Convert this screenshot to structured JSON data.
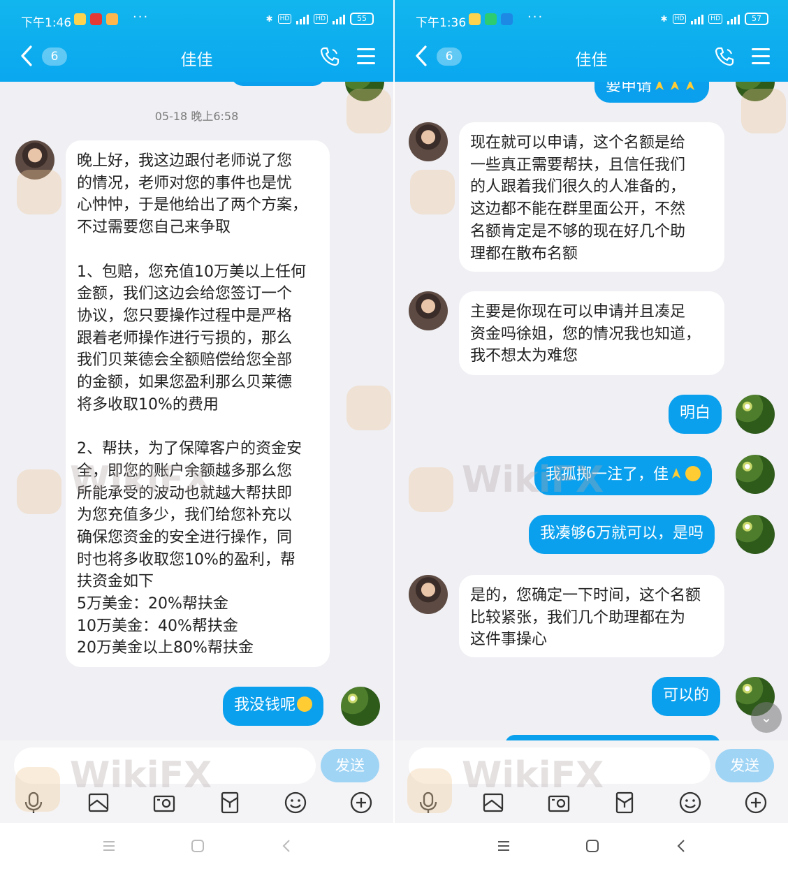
{
  "left": {
    "status": {
      "time": "下午1:46",
      "battery": "55"
    },
    "header": {
      "unread_badge": "6",
      "title": "佳佳"
    },
    "timestamp": "05-18 晚上6:58",
    "messages": [
      {
        "from": "them",
        "text": "晚上好，我这边跟付老师说了您\n的情况，老师对您的事件也是忧\n心忡忡，于是他给出了两个方案，\n不过需要您自己来争取\n\n1、包赔，您充值10万美以上任何\n金额，我们这边会给您签订一个\n协议，您只要操作过程中是严格\n跟着老师操作进行亏损的，那么\n我们贝莱德会全额赔偿给您全部\n的金额，如果您盈利那么贝莱德\n将多收取10%的费用\n\n2、帮扶，为了保障客户的资金安\n全，即您的账户余额越多那么您\n所能承受的波动也就越大帮扶即\n为您充值多少，我们给您补充以\n确保您资金的安全进行操作，同\n时也将多收取您10%的盈利，帮\n扶资金如下\n5万美金：20%帮扶金\n10万美金：40%帮扶金\n20万美金以上80%帮扶金"
      },
      {
        "from": "me",
        "text": "我没钱呢"
      }
    ],
    "send_label": "发送"
  },
  "right": {
    "status": {
      "time": "下午1:36",
      "battery": "57"
    },
    "header": {
      "unread_badge": "6",
      "title": "佳佳"
    },
    "partial_top": "要申请",
    "messages": [
      {
        "from": "them",
        "text": "现在就可以申请，这个名额是给\n一些真正需要帮扶，且信任我们\n的人跟着我们很久的人准备的，\n这边都不能在群里面公开，不然\n名额肯定是不够的现在好几个助\n理都在散布名额"
      },
      {
        "from": "them",
        "text": "主要是你现在可以申请并且凑足\n资金吗徐姐，您的情况我也知道，\n我不想太为难您"
      },
      {
        "from": "me",
        "text": "明白"
      },
      {
        "from": "me",
        "text": "我孤掷一注了，佳"
      },
      {
        "from": "me",
        "text": "我凑够6万就可以，是吗"
      },
      {
        "from": "them",
        "text": "是的，您确定一下时间，这个名额\n比较紧张，我们几个助理都在为\n这件事操心"
      },
      {
        "from": "me",
        "text": "可以的"
      }
    ],
    "send_label": "发送"
  },
  "watermark_text": "WikiFX",
  "icons": [
    "back-chevron-icon",
    "phone-icon",
    "menu-icon",
    "microphone-icon",
    "image-icon",
    "camera-icon",
    "red-packet-icon",
    "emoji-icon",
    "plus-icon"
  ],
  "colors": {
    "header": "#0aa7ef",
    "my_bubble": "#0aa0ee",
    "background": "#efeff4"
  }
}
